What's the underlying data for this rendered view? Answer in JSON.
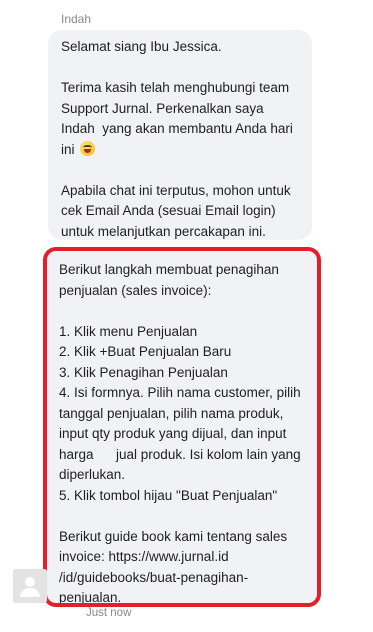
{
  "sender": "Indah",
  "message1": {
    "greeting": "Selamat siang Ibu Jessica.",
    "intro": "Terima kasih telah menghubungi team Support Jurnal. Perkenalkan saya Indah  yang akan membantu Anda hari ini",
    "emoji": "grinning-face-emoji",
    "note": "Apabila chat ini terputus, mohon untuk cek Email Anda (sesuai Email login) untuk melanjutkan percakapan ini."
  },
  "message2": {
    "lead": "Berikut langkah membuat penagihan penjualan (sales invoice):",
    "steps": [
      "1. Klik menu Penjualan",
      "2. Klik +Buat Penjualan Baru",
      "3. Klik Penagihan Penjualan",
      "4. Isi formnya. Pilih nama customer, pilih tanggal penjualan, pilih nama produk, input qty produk yang dijual, dan input harga      jual produk. Isi kolom lain yang diperlukan.",
      "5. Klik tombol hijau \"Buat Penjualan\""
    ],
    "guide": "Berikut guide book kami tentang sales invoice: https://www.jurnal.id /id/guidebooks/buat-penagihan-penjualan."
  },
  "timestamp": "Just now",
  "colors": {
    "bubble_bg": "#f1f2f6",
    "highlight_border": "#e41e2b",
    "muted_text": "#8a8a8a"
  }
}
